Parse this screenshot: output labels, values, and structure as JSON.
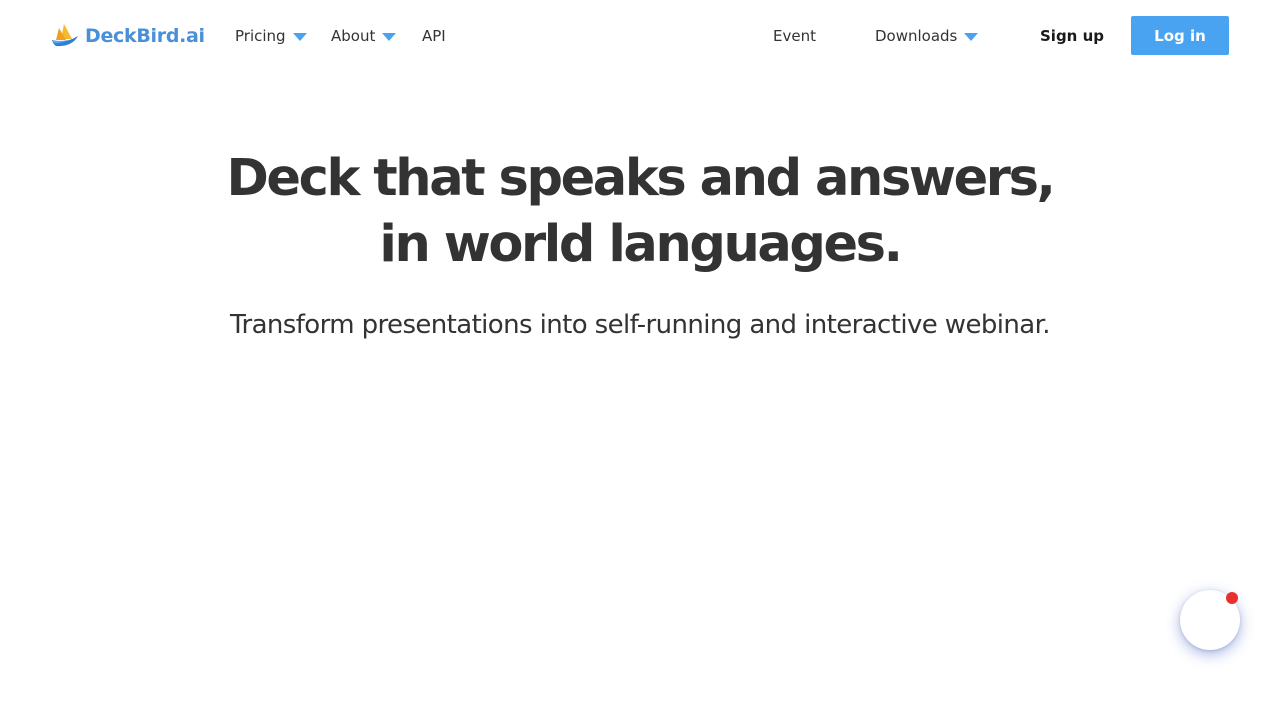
{
  "brand": {
    "name": "DeckBird.ai",
    "logo_icon": "bird-sail-logo-icon",
    "accent_color": "#4aa3f0"
  },
  "nav": {
    "items": [
      {
        "label": "Pricing",
        "has_dropdown": true
      },
      {
        "label": "About",
        "has_dropdown": true
      },
      {
        "label": "API",
        "has_dropdown": false
      },
      {
        "label": "Event",
        "has_dropdown": false
      },
      {
        "label": "Downloads",
        "has_dropdown": true
      }
    ],
    "signup_label": "Sign up",
    "login_label": "Log in"
  },
  "hero": {
    "title_line1": "Deck that speaks and answers,",
    "title_line2": "in world languages.",
    "subtitle": "Transform presentations into self-running and interactive webinar."
  },
  "chat_widget": {
    "icon": "chat-launcher-icon",
    "notification_color": "#e8302f"
  }
}
